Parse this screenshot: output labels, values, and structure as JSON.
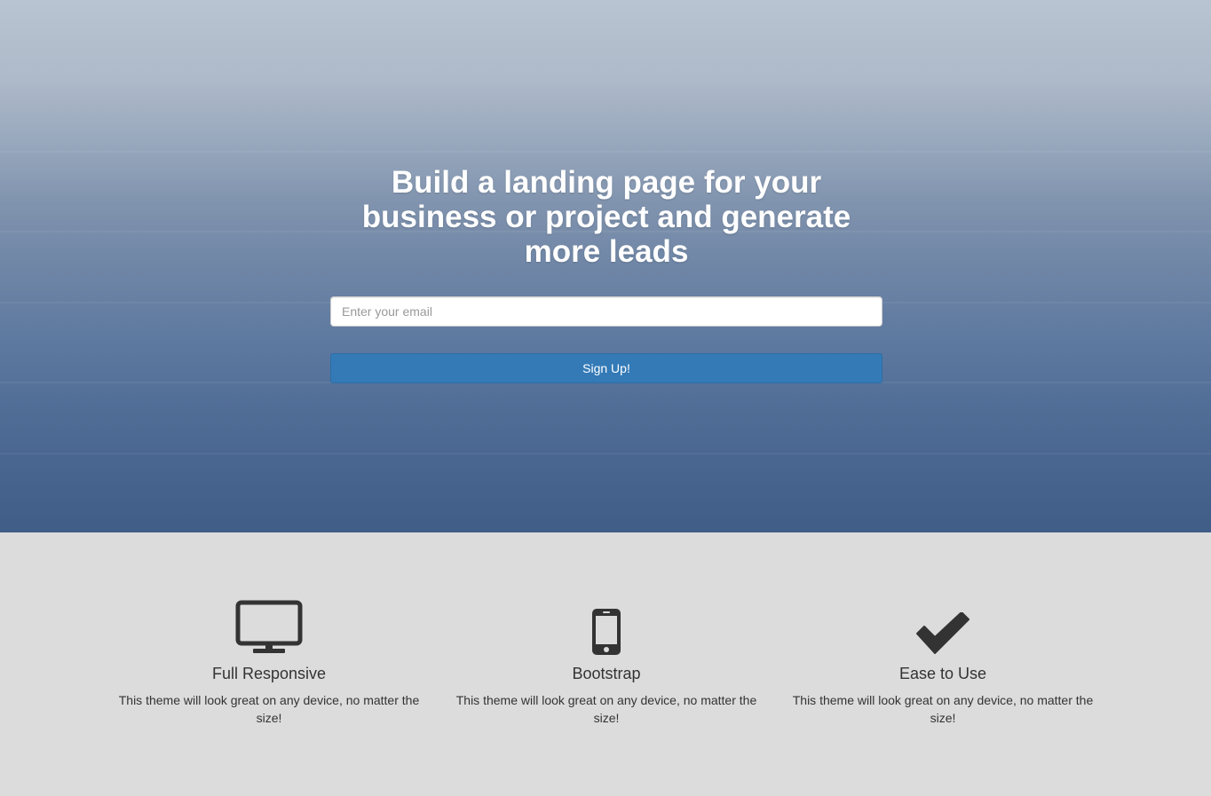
{
  "hero": {
    "title": "Build a landing page for your business or project and generate more leads",
    "email_placeholder": "Enter your email",
    "signup_label": "Sign Up!"
  },
  "features": [
    {
      "icon": "desktop-icon",
      "title": "Full Responsive",
      "text": "This theme will look great on any device, no matter the size!"
    },
    {
      "icon": "mobile-phone-icon",
      "title": "Bootstrap",
      "text": "This theme will look great on any device, no matter the size!"
    },
    {
      "icon": "checkmark-icon",
      "title": "Ease to Use",
      "text": "This theme will look great on any device, no matter the size!"
    }
  ],
  "colors": {
    "primary_button": "#337ab7",
    "features_background": "#dcdcdc",
    "text": "#333333"
  }
}
